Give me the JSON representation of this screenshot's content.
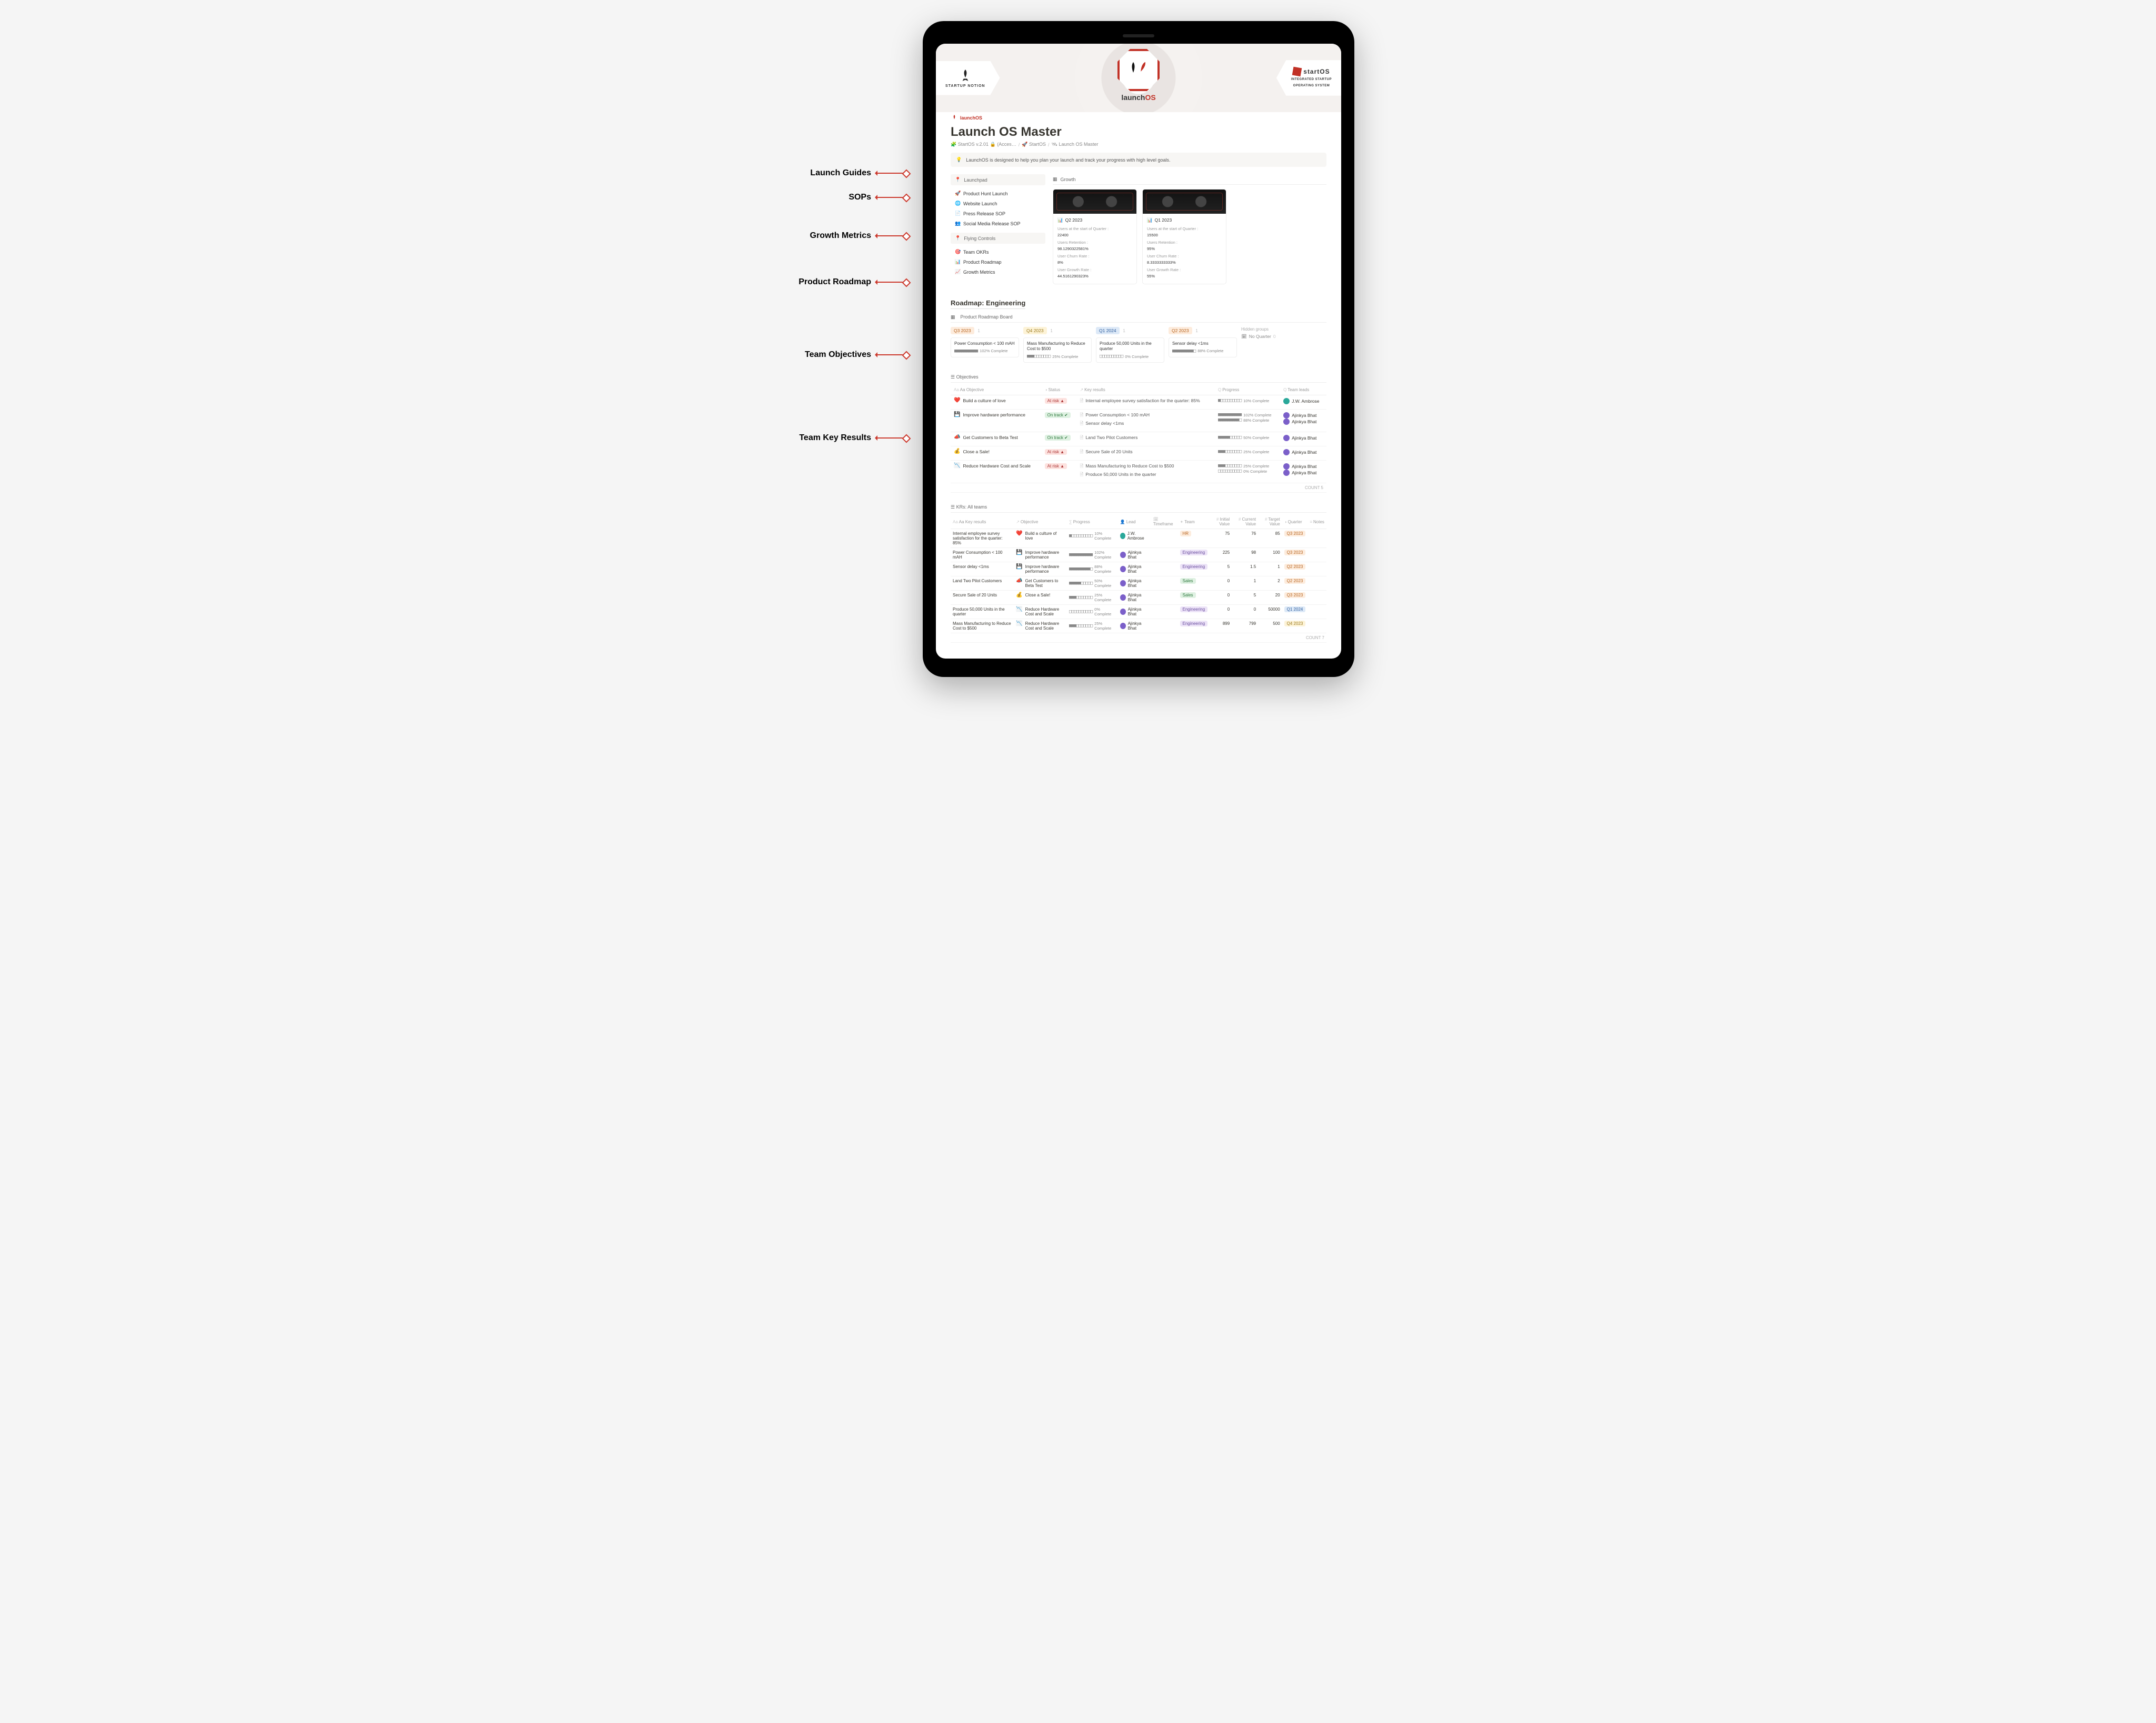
{
  "annotations": {
    "launch_guides": "Launch Guides",
    "sops": "SOPs",
    "growth_metrics": "Growth Metrics",
    "product_roadmap": "Product Roadmap",
    "team_objectives": "Team Objectives",
    "team_key_results": "Team Key Results"
  },
  "banner": {
    "left_label": "STARTUP NOTION",
    "center_brand_a": "launch",
    "center_brand_b": "OS",
    "right_brand": "startOS",
    "right_sub1": "INTEGRATED STARTUP",
    "right_sub2": "OPERATING SYSTEM",
    "small_brand_a": "launch",
    "small_brand_b": "OS"
  },
  "page": {
    "title": "Launch OS Master",
    "breadcrumb": [
      "🧩 StartOS v.2.01 🔒 (Acces…",
      "🚀 StartOS",
      "🛰 Launch OS Master"
    ],
    "callout_icon": "💡",
    "callout": "LaunchOS is designed to help you plan your launch and track your progress with high level goals."
  },
  "leftnav": {
    "launchpad": "Launchpad",
    "items1": [
      {
        "icon": "🚀",
        "label": "Product Hunt Launch"
      },
      {
        "icon": "🌐",
        "label": "Website Launch"
      },
      {
        "icon": "📄",
        "label": "Press Release SOP"
      },
      {
        "icon": "👥",
        "label": "Social Media Release SOP"
      }
    ],
    "flying": "Flying Controls",
    "items2": [
      {
        "icon": "🎯",
        "label": "Team OKRs"
      },
      {
        "icon": "📊",
        "label": "Product Roadmap"
      },
      {
        "icon": "📈",
        "label": "Growth Metrics"
      }
    ]
  },
  "growth": {
    "tab": "Growth",
    "cards": [
      {
        "title": "Q2 2023",
        "rows": [
          {
            "k": "Users at the start of Quarter :",
            "v": "22400"
          },
          {
            "k": "Users Retention :",
            "v": "98.1290322581%"
          },
          {
            "k": "User Churn Rate :",
            "v": "8%"
          },
          {
            "k": "User Growth Rate :",
            "v": "44.5161290323%"
          }
        ]
      },
      {
        "title": "Q1 2023",
        "rows": [
          {
            "k": "Users at the start of Quarter :",
            "v": "15500"
          },
          {
            "k": "Users Retention :",
            "v": "95%"
          },
          {
            "k": "User Churn Rate :",
            "v": "8.3333333333%"
          },
          {
            "k": "User Growth Rate :",
            "v": "55%"
          }
        ]
      }
    ]
  },
  "roadmap": {
    "title": "Roadmap: Engineering",
    "tab": "Product Roadmap Board",
    "hidden": "Hidden groups",
    "no_quarter": "No Quarter",
    "no_quarter_count": "0",
    "cols": [
      {
        "tag": "Q3 2023",
        "tag_cls": "tag-orange",
        "count": "1",
        "card": {
          "title": "Power Consumption < 100 mAH",
          "bar": "■■■■■■■■■■",
          "pct": "102% Complete"
        }
      },
      {
        "tag": "Q4 2023",
        "tag_cls": "tag-yellow",
        "count": "1",
        "card": {
          "title": "Mass Manufacturing to Reduce Cost to $500",
          "bar": "■■■□□□□□□□",
          "pct": "25% Complete"
        }
      },
      {
        "tag": "Q1 2024",
        "tag_cls": "tag-blue",
        "count": "1",
        "card": {
          "title": "Produce 50,000 Units in the quarter",
          "bar": "□□□□□□□□□□",
          "pct": "0% Complete"
        }
      },
      {
        "tag": "Q2 2023",
        "tag_cls": "tag-orange",
        "count": "1",
        "card": {
          "title": "Sensor delay <1ms",
          "bar": "■■■■■■■■■□",
          "pct": "88% Complete"
        }
      }
    ]
  },
  "objectives": {
    "tab": "Objectives",
    "headers": {
      "obj": "Aa Objective",
      "status": "Status",
      "kr": "Key results",
      "prog": "Progress",
      "leads": "Team leads"
    },
    "rows": [
      {
        "emoji": "❤️",
        "title": "Build a culture of love",
        "status": "At risk ▲",
        "status_cls": "tag-red",
        "krs": [
          {
            "t": "Internal employee survey satisfaction for the quarter: 85%"
          }
        ],
        "progress": [
          {
            "bar": "■□□□□□□□□□",
            "pct": "10% Complete"
          }
        ],
        "leads": [
          {
            "av": "av-teal",
            "name": "J.W. Ambrose"
          }
        ]
      },
      {
        "emoji": "💾",
        "title": "Improve hardware performance",
        "status": "On track ✔",
        "status_cls": "tag-green",
        "krs": [
          {
            "t": "Power Consumption < 100 mAH"
          },
          {
            "t": "Sensor delay <1ms"
          }
        ],
        "progress": [
          {
            "bar": "■■■■■■■■■■",
            "pct": "102% Complete"
          },
          {
            "bar": "■■■■■■■■■□",
            "pct": "88% Complete"
          }
        ],
        "leads": [
          {
            "av": "av-purple",
            "name": "Ajinkya Bhat"
          },
          {
            "av": "av-purple",
            "name": "Ajinkya Bhat"
          }
        ]
      },
      {
        "emoji": "📣",
        "title": "Get Customers to Beta Test",
        "status": "On track ✔",
        "status_cls": "tag-green",
        "krs": [
          {
            "t": "Land Two Pilot Customers"
          }
        ],
        "progress": [
          {
            "bar": "■■■■■□□□□□",
            "pct": "50% Complete"
          }
        ],
        "leads": [
          {
            "av": "av-purple",
            "name": "Ajinkya Bhat"
          }
        ]
      },
      {
        "emoji": "💰",
        "title": "Close a Sale!",
        "status": "At risk ▲",
        "status_cls": "tag-red",
        "krs": [
          {
            "t": "Secure Sale of 20 Units"
          }
        ],
        "progress": [
          {
            "bar": "■■■□□□□□□□",
            "pct": "25% Complete"
          }
        ],
        "leads": [
          {
            "av": "av-purple",
            "name": "Ajinkya Bhat"
          }
        ]
      },
      {
        "emoji": "📉",
        "title": "Reduce Hardware Cost and Scale",
        "status": "At risk ▲",
        "status_cls": "tag-red",
        "krs": [
          {
            "t": "Mass Manufacturing to Reduce Cost to $500"
          },
          {
            "t": "Produce 50,000 Units in the quarter"
          }
        ],
        "progress": [
          {
            "bar": "■■■□□□□□□□",
            "pct": "25% Complete"
          },
          {
            "bar": "□□□□□□□□□□",
            "pct": "0% Complete"
          }
        ],
        "leads": [
          {
            "av": "av-purple",
            "name": "Ajinkya Bhat"
          },
          {
            "av": "av-purple",
            "name": "Ajinkya Bhat"
          }
        ]
      }
    ],
    "count_label": "COUNT",
    "count": "5"
  },
  "krs": {
    "tab": "KRs: All teams",
    "headers": {
      "kr": "Aa Key results",
      "obj": "Objective",
      "prog": "Progress",
      "lead": "Lead",
      "tf": "Timeframe",
      "team": "Team",
      "init": "Initial Value",
      "curr": "Current Value",
      "targ": "Target Value",
      "q": "Quarter",
      "notes": "Notes"
    },
    "rows": [
      {
        "kr": "Internal employee survey satisfaction for the quarter: 85%",
        "obj_e": "❤️",
        "obj": "Build a culture of love",
        "bar": "■□□□□□□□□□",
        "pct": "10% Complete",
        "lead_av": "av-teal",
        "lead": "J.W. Ambrose",
        "team": "HR",
        "team_cls": "tag-orange",
        "init": "75",
        "curr": "76",
        "targ": "85",
        "q": "Q3 2023",
        "q_cls": "tag-orange"
      },
      {
        "kr": "Power Consumption < 100 mAH",
        "obj_e": "💾",
        "obj": "Improve hardware performance",
        "bar": "■■■■■■■■■■",
        "pct": "102% Complete",
        "lead_av": "av-purple",
        "lead": "Ajinkya Bhat",
        "team": "Engineering",
        "team_cls": "tag-purple",
        "init": "225",
        "curr": "98",
        "targ": "100",
        "q": "Q3 2023",
        "q_cls": "tag-orange"
      },
      {
        "kr": "Sensor delay <1ms",
        "obj_e": "💾",
        "obj": "Improve hardware performance",
        "bar": "■■■■■■■■■□",
        "pct": "88% Complete",
        "lead_av": "av-purple",
        "lead": "Ajinkya Bhat",
        "team": "Engineering",
        "team_cls": "tag-purple",
        "init": "5",
        "curr": "1.5",
        "targ": "1",
        "q": "Q2 2023",
        "q_cls": "tag-orange"
      },
      {
        "kr": "Land Two Pilot Customers",
        "obj_e": "📣",
        "obj": "Get Customers to Beta Test",
        "bar": "■■■■■□□□□□",
        "pct": "50% Complete",
        "lead_av": "av-purple",
        "lead": "Ajinkya Bhat",
        "team": "Sales",
        "team_cls": "tag-green",
        "init": "0",
        "curr": "1",
        "targ": "2",
        "q": "Q2 2023",
        "q_cls": "tag-orange"
      },
      {
        "kr": "Secure Sale of 20 Units",
        "obj_e": "💰",
        "obj": "Close a Sale!",
        "bar": "■■■□□□□□□□",
        "pct": "25% Complete",
        "lead_av": "av-purple",
        "lead": "Ajinkya Bhat",
        "team": "Sales",
        "team_cls": "tag-green",
        "init": "0",
        "curr": "5",
        "targ": "20",
        "q": "Q3 2023",
        "q_cls": "tag-orange"
      },
      {
        "kr": "Produce 50,000 Units in the quarter",
        "obj_e": "📉",
        "obj": "Reduce Hardware Cost and Scale",
        "bar": "□□□□□□□□□□",
        "pct": "0% Complete",
        "lead_av": "av-purple",
        "lead": "Ajinkya Bhat",
        "team": "Engineering",
        "team_cls": "tag-purple",
        "init": "0",
        "curr": "0",
        "targ": "50000",
        "q": "Q1 2024",
        "q_cls": "tag-blue"
      },
      {
        "kr": "Mass Manufacturing to Reduce Cost to $500",
        "obj_e": "📉",
        "obj": "Reduce Hardware Cost and Scale",
        "bar": "■■■□□□□□□□",
        "pct": "25% Complete",
        "lead_av": "av-purple",
        "lead": "Ajinkya Bhat",
        "team": "Engineering",
        "team_cls": "tag-purple",
        "init": "899",
        "curr": "799",
        "targ": "500",
        "q": "Q4 2023",
        "q_cls": "tag-yellow"
      }
    ],
    "count_label": "COUNT",
    "count": "7"
  }
}
